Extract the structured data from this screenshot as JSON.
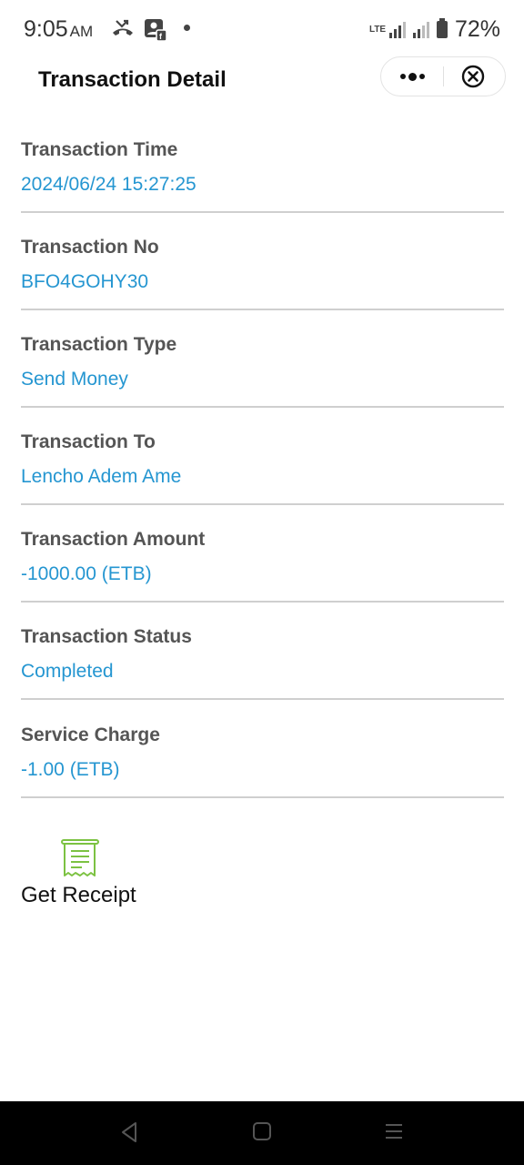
{
  "status_bar": {
    "time": "9:05",
    "ampm": "AM",
    "network": "LTE",
    "battery": "72%",
    "icons": [
      "missed-call-icon",
      "contact-card-icon",
      "notification-dot-icon",
      "signal-icon",
      "battery-icon"
    ]
  },
  "header": {
    "title": "Transaction Detail",
    "icons": [
      "more-icon",
      "close-circle-icon"
    ]
  },
  "details": [
    {
      "label": "Transaction Time",
      "value": "2024/06/24 15:27:25"
    },
    {
      "label": "Transaction No",
      "value": "BFO4GOHY30"
    },
    {
      "label": "Transaction Type",
      "value": "Send Money"
    },
    {
      "label": "Transaction To",
      "value": "Lencho Adem Ame"
    },
    {
      "label": "Transaction Amount",
      "value": "-1000.00 (ETB)"
    },
    {
      "label": "Transaction Status",
      "value": "Completed"
    },
    {
      "label": "Service Charge",
      "value": "-1.00 (ETB)"
    }
  ],
  "receipt": {
    "label": "Get Receipt",
    "icon": "receipt-icon"
  },
  "colors": {
    "value_text": "#2596d1",
    "label_text": "#555555",
    "receipt_icon": "#7cc242",
    "divider": "#cfcfcf"
  },
  "nav_bar": {
    "icons": [
      "back-icon",
      "home-icon",
      "menu-icon"
    ]
  }
}
